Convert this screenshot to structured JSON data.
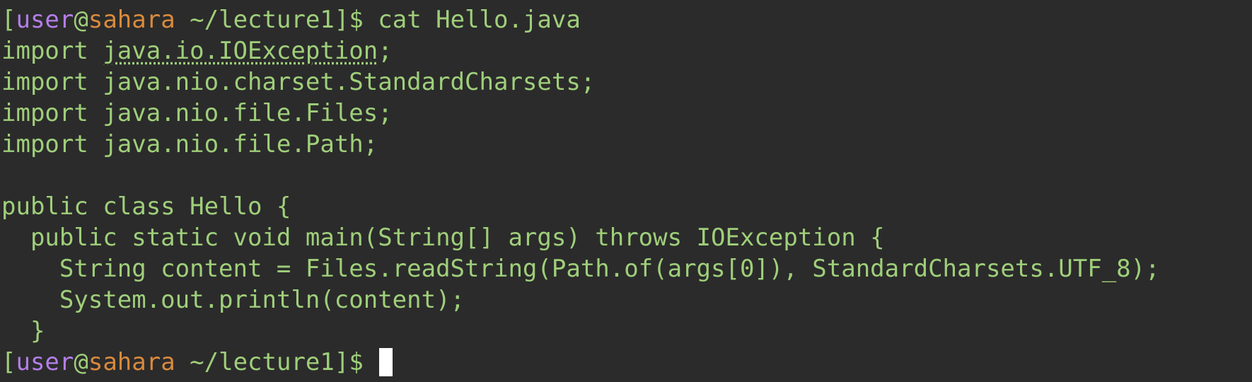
{
  "terminal": {
    "partial_top_line": "  String content = Files.readString(Path.of(args[0]), StandardCharsets.UTF_8);",
    "prompt1": {
      "open_bracket": "[",
      "user": "user",
      "at": "@",
      "host": "sahara",
      "dir": " ~/lecture1]$ ",
      "command": "cat Hello.java"
    },
    "code_lines": {
      "import_io_kw": "import ",
      "import_io_pkg": "java.io.IOException",
      "import_io_semicolon": ";",
      "import_charsets": "import java.nio.charset.StandardCharsets;",
      "import_files": "import java.nio.file.Files;",
      "import_path": "import java.nio.file.Path;",
      "blank": "",
      "class_decl": "public class Hello {",
      "main_decl": "  public static void main(String[] args) throws IOException {",
      "read_line": "    String content = Files.readString(Path.of(args[0]), StandardCharsets.UTF_8);",
      "print_line": "    System.out.println(content);",
      "close_method": "  }",
      "close_class": "}"
    },
    "prompt2": {
      "open_bracket": "[",
      "user": "user",
      "at": "@",
      "host": "sahara",
      "dir": " ~/lecture1]$ "
    },
    "colors": {
      "background": "#2b2b2b",
      "text": "#9fcf7a",
      "user": "#b47ee8",
      "host": "#d98a3c",
      "cursor": "#ffffff"
    }
  }
}
